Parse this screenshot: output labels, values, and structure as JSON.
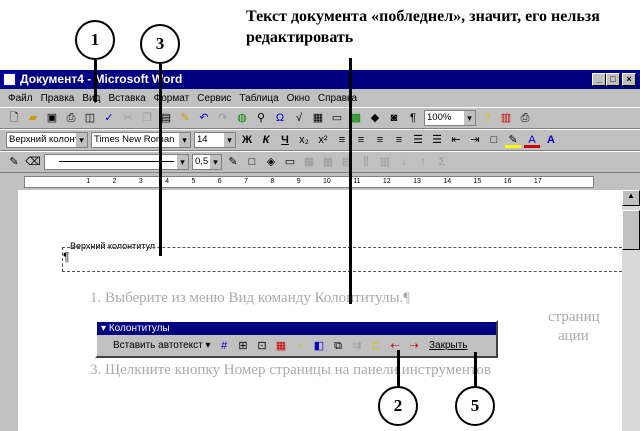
{
  "caption": "Текст документа «побледнел», значит, его нельзя редактировать",
  "callouts": [
    "1",
    "3",
    "2",
    "5"
  ],
  "window": {
    "title": "Документ4 - Microsoft Word",
    "controls": [
      "_",
      "□",
      "×"
    ]
  },
  "menu": [
    "Файл",
    "Правка",
    "Вид",
    "Вставка",
    "Формат",
    "Сервис",
    "Таблица",
    "Окно",
    "Справка"
  ],
  "toolbar_standard": {
    "zoom": "100%"
  },
  "toolbar_format": {
    "style": "Верхний колонт",
    "font": "Times New Roman",
    "size": "14",
    "bold": "Ж",
    "italic": "К",
    "underline": "Ч"
  },
  "toolbar_drawing": {
    "line_width": "0,5"
  },
  "ruler_ticks": [
    "1",
    "2",
    "3",
    "4",
    "5",
    "6",
    "7",
    "8",
    "9",
    "10",
    "11",
    "12",
    "13",
    "14",
    "15",
    "16",
    "17"
  ],
  "document": {
    "header_label": "Верхний колонтитул",
    "pilcrow": "¶",
    "lines": [
      "1. Выберите из меню Вид команду Колонтитулы.¶",
      "страниц",
      "ации",
      "3. Щелкните кнопку Номер страницы на панели инструментов"
    ]
  },
  "hf_toolbar": {
    "title": "Колонтитулы",
    "insert_autotext": "Вставить автотекст",
    "close": "Закрыть"
  }
}
